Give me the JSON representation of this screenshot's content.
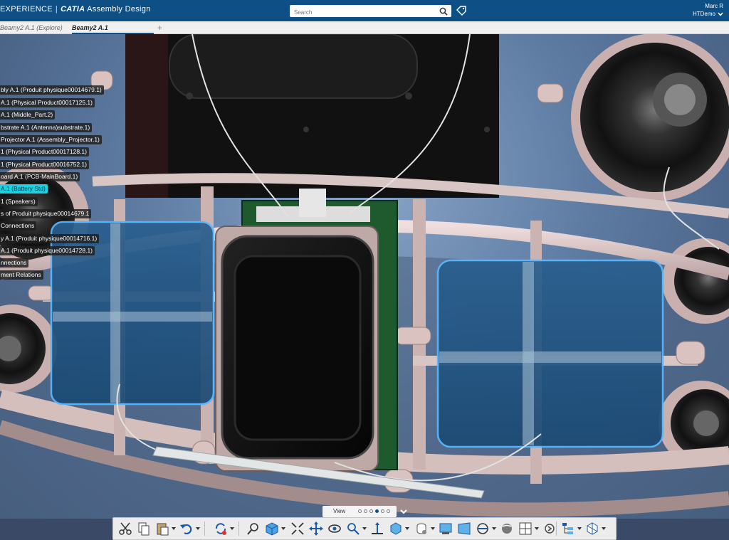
{
  "header": {
    "app_prefix": "EXPERIENCE",
    "app_separator": "|",
    "app_brand": "CATIA",
    "app_name": "Assembly Design",
    "search_placeholder": "Search",
    "user_name": "Marc R",
    "user_tenant": "HTDemo"
  },
  "tabs": [
    {
      "label": "Beamy2 A.1 (Explore)"
    },
    {
      "label": "Beamy2 A.1"
    }
  ],
  "tab_add": "+",
  "tree": [
    "bly A.1 (Produit physique00014679.1)",
    "A.1 (Physical Product00017125.1)",
    "A.1 (Middle_Part.2)",
    "bstrate A.1 (Antenna)substrate.1)",
    "Projector A.1 (Assembly_Projector.1)",
    "1 (Physical Product00017128.1)",
    "1 (Physical Product00016752.1)",
    "oard A.1 (PCB-MainBoard.1)",
    "A.1 (Battery Std)",
    "1 (Speakers)",
    "s of Produit physique00014679.1",
    "Connections",
    "y A.1 (Produit physique00014716.1)",
    "A.1 (Produit physique00014728.1)",
    "nnections",
    "ment Relations"
  ],
  "tree_selected_index": 8,
  "viewbar": {
    "label": "View",
    "active_dot": 3,
    "dot_count": 6
  },
  "toolbar": {
    "tools": [
      "cut-icon",
      "copy-icon",
      "paste-icon",
      "undo-icon",
      "update-icon",
      "zoom-area-icon",
      "view-cube-icon",
      "fit-all-icon",
      "pan-icon",
      "rotate-icon",
      "zoom-icon",
      "normal-view-icon",
      "view-mode-icon",
      "hide-show-icon",
      "capture-icon",
      "perspective-icon",
      "clipping-icon",
      "render-style-icon",
      "multi-view-icon",
      "more-icon",
      "tree-icon",
      "compass-icon"
    ]
  },
  "colors": {
    "header_bg": "#0e4f86",
    "selection": "#1fd0e0",
    "battery_highlight": "#58b8ff"
  }
}
